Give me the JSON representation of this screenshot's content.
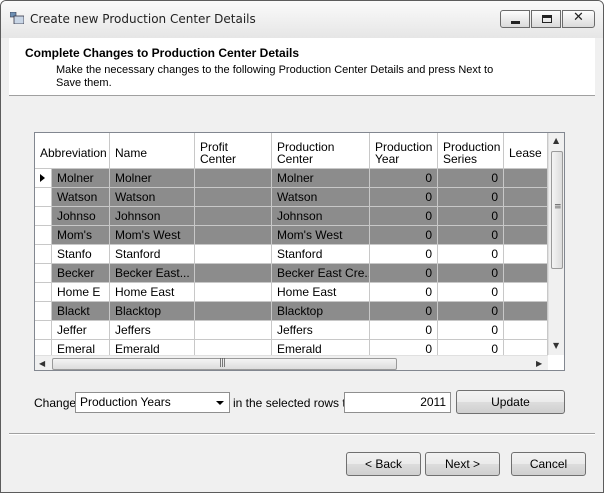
{
  "window": {
    "title": "Create new Production Center Details"
  },
  "header": {
    "title": "Complete Changes to Production Center Details",
    "subtitle": "Make the necessary changes to the following Production Center Details and press Next to Save them."
  },
  "grid": {
    "columns": [
      "Abbreviation",
      "Name",
      "Profit Center",
      "Production Center",
      "Production Year",
      "Production Series",
      "Lease"
    ],
    "rows": [
      {
        "abbreviation": "Molner",
        "name": "Molner",
        "profit_center": "",
        "production_center": "Molner",
        "production_year": "0",
        "production_series": "0",
        "lease": "",
        "selected": true,
        "current": true
      },
      {
        "abbreviation": "Watson",
        "name": "Watson",
        "profit_center": "",
        "production_center": "Watson",
        "production_year": "0",
        "production_series": "0",
        "lease": "",
        "selected": true
      },
      {
        "abbreviation": "Johnso",
        "name": "Johnson",
        "profit_center": "",
        "production_center": "Johnson",
        "production_year": "0",
        "production_series": "0",
        "lease": "",
        "selected": true
      },
      {
        "abbreviation": "Mom's",
        "name": "Mom's West",
        "profit_center": "",
        "production_center": "Mom's West",
        "production_year": "0",
        "production_series": "0",
        "lease": "",
        "selected": true
      },
      {
        "abbreviation": "Stanfo",
        "name": "Stanford",
        "profit_center": "",
        "production_center": "Stanford",
        "production_year": "0",
        "production_series": "0",
        "lease": "",
        "selected": false
      },
      {
        "abbreviation": "Becker",
        "name": "Becker  East...",
        "profit_center": "",
        "production_center": "Becker  East  Cre...",
        "production_year": "0",
        "production_series": "0",
        "lease": "",
        "selected": true
      },
      {
        "abbreviation": "Home E",
        "name": "Home East",
        "profit_center": "",
        "production_center": "Home East",
        "production_year": "0",
        "production_series": "0",
        "lease": "",
        "selected": false
      },
      {
        "abbreviation": "Blackt",
        "name": "Blacktop",
        "profit_center": "",
        "production_center": "Blacktop",
        "production_year": "0",
        "production_series": "0",
        "lease": "",
        "selected": true
      },
      {
        "abbreviation": "Jeffer",
        "name": "Jeffers",
        "profit_center": "",
        "production_center": "Jeffers",
        "production_year": "0",
        "production_series": "0",
        "lease": "",
        "selected": false
      },
      {
        "abbreviation": "Emeral",
        "name": "Emerald",
        "profit_center": "",
        "production_center": "Emerald",
        "production_year": "0",
        "production_series": "0",
        "lease": "",
        "selected": false
      }
    ]
  },
  "change_bar": {
    "change_label": "Change",
    "field_selected": "Production Years",
    "middle_label": "in the selected rows to",
    "value": "2011",
    "update_label": "Update"
  },
  "footer": {
    "back_label": "< Back",
    "next_label": "Next >",
    "cancel_label": "Cancel"
  },
  "icons": {
    "app": "app-window-icon",
    "minimize": "minimize-icon",
    "maximize": "maximize-icon",
    "close": "close-icon"
  }
}
